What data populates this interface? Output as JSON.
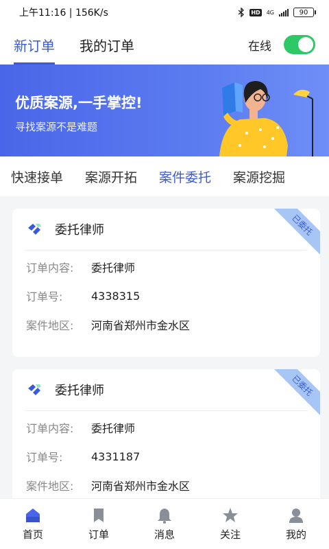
{
  "status_bar": {
    "time_speed": "上午11:16 | 156K/s",
    "hd": "HD",
    "network": "4G",
    "battery": "90"
  },
  "top_tabs": [
    {
      "label": "新订单",
      "active": true
    },
    {
      "label": "我的订单",
      "active": false
    }
  ],
  "online": {
    "label": "在线",
    "on": true
  },
  "banner": {
    "title": "优质案源,一手掌控!",
    "subtitle": "寻找案源不是难题"
  },
  "category_tabs": [
    {
      "label": "快速接单",
      "active": false
    },
    {
      "label": "案源开拓",
      "active": false
    },
    {
      "label": "案件委托",
      "active": true
    },
    {
      "label": "案源挖掘",
      "active": false
    }
  ],
  "cards": [
    {
      "title": "委托律师",
      "ribbon": "已委托",
      "rows": [
        {
          "label": "订单内容:",
          "value": "委托律师"
        },
        {
          "label": "订单号:",
          "value": "4338315"
        },
        {
          "label": "案件地区:",
          "value": "河南省郑州市金水区"
        }
      ]
    },
    {
      "title": "委托律师",
      "ribbon": "已委托",
      "rows": [
        {
          "label": "订单内容:",
          "value": "委托律师"
        },
        {
          "label": "订单号:",
          "value": "4331187"
        },
        {
          "label": "案件地区:",
          "value": "河南省郑州市金水区"
        }
      ]
    }
  ],
  "bottom_nav": [
    {
      "label": "首页",
      "icon": "home-icon",
      "active": true
    },
    {
      "label": "订单",
      "icon": "bookmark-icon",
      "active": false
    },
    {
      "label": "消息",
      "icon": "bell-icon",
      "active": false
    },
    {
      "label": "关注",
      "icon": "star-icon",
      "active": false
    },
    {
      "label": "我的",
      "icon": "user-icon",
      "active": false
    }
  ],
  "colors": {
    "accent": "#3a5bd9",
    "toggle_on": "#2ec866",
    "banner": "#5470ec",
    "ribbon": "#a7c6f5"
  }
}
